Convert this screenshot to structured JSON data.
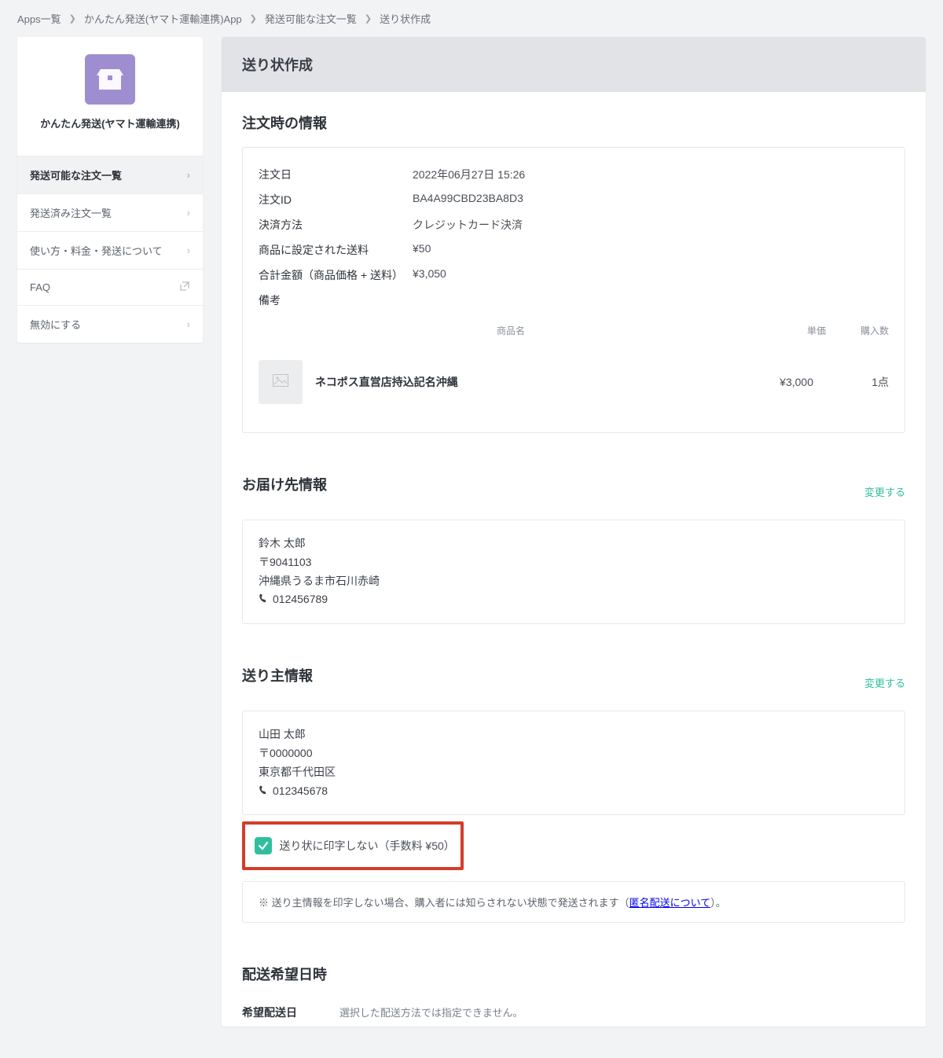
{
  "breadcrumb": [
    "Apps一覧",
    "かんたん発送(ヤマト運輸連携)App",
    "発送可能な注文一覧",
    "送り状作成"
  ],
  "sidebar": {
    "app_title": "かんたん発送(ヤマト運輸連携)",
    "items": [
      {
        "label": "発送可能な注文一覧",
        "active": true,
        "type": "chevron"
      },
      {
        "label": "発送済み注文一覧",
        "type": "chevron"
      },
      {
        "label": "使い方・料金・発送について",
        "type": "chevron"
      },
      {
        "label": "FAQ",
        "type": "external"
      },
      {
        "label": "無効にする",
        "type": "chevron"
      }
    ]
  },
  "page_title": "送り状作成",
  "order_info": {
    "heading": "注文時の情報",
    "rows": [
      {
        "k": "注文日",
        "v": "2022年06月27日 15:26"
      },
      {
        "k": "注文ID",
        "v": "BA4A99CBD23BA8D3"
      },
      {
        "k": "決済方法",
        "v": "クレジットカード決済"
      },
      {
        "k": "商品に設定された送料",
        "v": "¥50"
      },
      {
        "k": "合計金額（商品価格 + 送料）",
        "v": "¥3,050"
      },
      {
        "k": "備考",
        "v": ""
      }
    ],
    "product_header": {
      "name": "商品名",
      "price": "単価",
      "qty": "購入数"
    },
    "products": [
      {
        "name": "ネコポス直営店持込記名沖縄",
        "price": "¥3,000",
        "qty": "1点"
      }
    ]
  },
  "delivery": {
    "heading": "お届け先情報",
    "change": "変更する",
    "name": "鈴木 太郎",
    "postal": "〒9041103",
    "address": "沖縄県うるま市石川赤崎",
    "phone": "012456789"
  },
  "sender": {
    "heading": "送り主情報",
    "change": "変更する",
    "name": "山田 太郎",
    "postal": "〒0000000",
    "address": "東京都千代田区",
    "phone": "012345678",
    "checkbox_label": "送り状に印字しない（手数料 ¥50）",
    "note_prefix": "※ 送り主情報を印字しない場合、購入者には知らされない状態で発送されます（",
    "note_link": "匿名配送について",
    "note_suffix": "）。"
  },
  "schedule": {
    "heading": "配送希望日時",
    "row_label": "希望配送日",
    "row_value": "選択した配送方法では指定できません。"
  }
}
